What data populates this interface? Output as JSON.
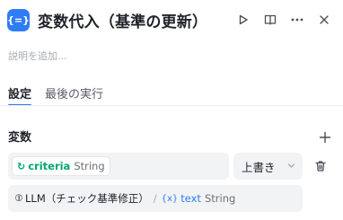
{
  "header": {
    "icon_text": "{=}",
    "title": "変数代入（基準の更新）"
  },
  "description_placeholder": "説明を追加...",
  "tabs": [
    {
      "label": "設定",
      "active": true
    },
    {
      "label": "最後の実行",
      "active": false
    }
  ],
  "variables_section": {
    "label": "変数",
    "assignment": {
      "target": {
        "name": "criteria",
        "type": "String"
      },
      "operation": "上書き",
      "source": {
        "node": "LLM（チェック基準修正）",
        "separator": "/",
        "icon_text": "{x}",
        "name": "text",
        "type": "String"
      }
    }
  },
  "colors": {
    "accent": "#2e7cf6",
    "variable_green": "#00a870",
    "field_bg": "#f2f3f5"
  }
}
